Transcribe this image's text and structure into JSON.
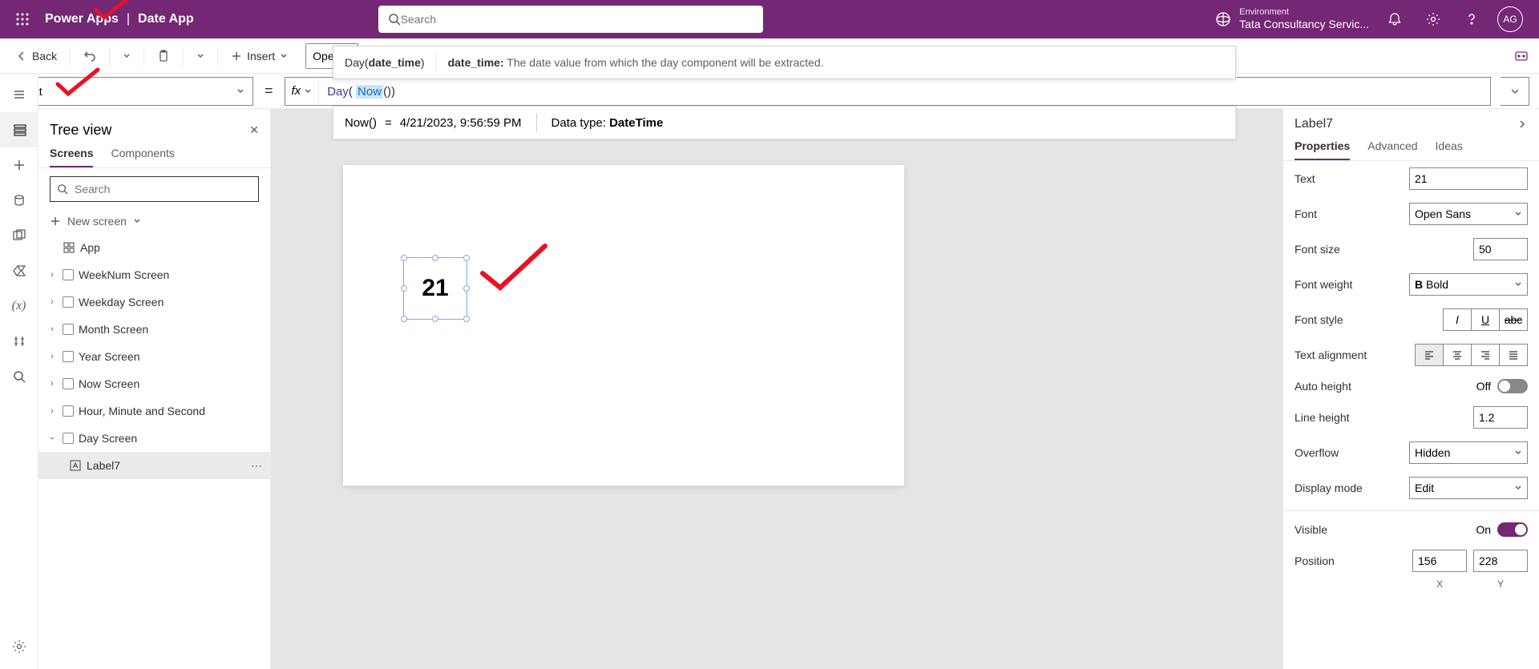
{
  "header": {
    "brand": "Power Apps",
    "app_name": "Date App",
    "search_placeholder": "Search",
    "env_label": "Environment",
    "env_name": "Tata Consultancy Servic...",
    "avatar": "AG"
  },
  "cmdbar": {
    "back": "Back",
    "insert": "Insert",
    "open_sans": "Open S"
  },
  "formula": {
    "property": "Text",
    "fx": "fx",
    "fn": "Day",
    "inner_fn": "Now",
    "sig_fn": "Day(",
    "sig_param": "date_time",
    "sig_close": ")",
    "param_name": "date_time:",
    "param_desc": "The date value from which the day component will be extracted."
  },
  "result": {
    "expr": "Now()",
    "value": "4/21/2023, 9:56:59 PM",
    "datatype_label": "Data type:",
    "datatype": "DateTime"
  },
  "tree": {
    "title": "Tree view",
    "tab_screens": "Screens",
    "tab_components": "Components",
    "search_placeholder": "Search",
    "new_screen": "New screen",
    "app": "App",
    "items": [
      "WeekNum Screen",
      "Weekday Screen",
      "Month Screen",
      "Year Screen",
      "Now Screen",
      "Hour, Minute and Second",
      "Day Screen"
    ],
    "selected_child": "Label7"
  },
  "canvas": {
    "label_text": "21"
  },
  "rp": {
    "title": "Label7",
    "tab_props": "Properties",
    "tab_adv": "Advanced",
    "tab_ideas": "Ideas",
    "text_label": "Text",
    "text_value": "21",
    "font_label": "Font",
    "font_value": "Open Sans",
    "fontsize_label": "Font size",
    "fontsize_value": "50",
    "fontweight_label": "Font weight",
    "fontweight_value": "Bold",
    "fontstyle_label": "Font style",
    "align_label": "Text alignment",
    "autoheight_label": "Auto height",
    "autoheight_value": "Off",
    "lineheight_label": "Line height",
    "lineheight_value": "1.2",
    "overflow_label": "Overflow",
    "overflow_value": "Hidden",
    "displaymode_label": "Display mode",
    "displaymode_value": "Edit",
    "visible_label": "Visible",
    "visible_value": "On",
    "position_label": "Position",
    "pos_x": "156",
    "pos_y": "228",
    "pos_x_label": "X",
    "pos_y_label": "Y"
  }
}
